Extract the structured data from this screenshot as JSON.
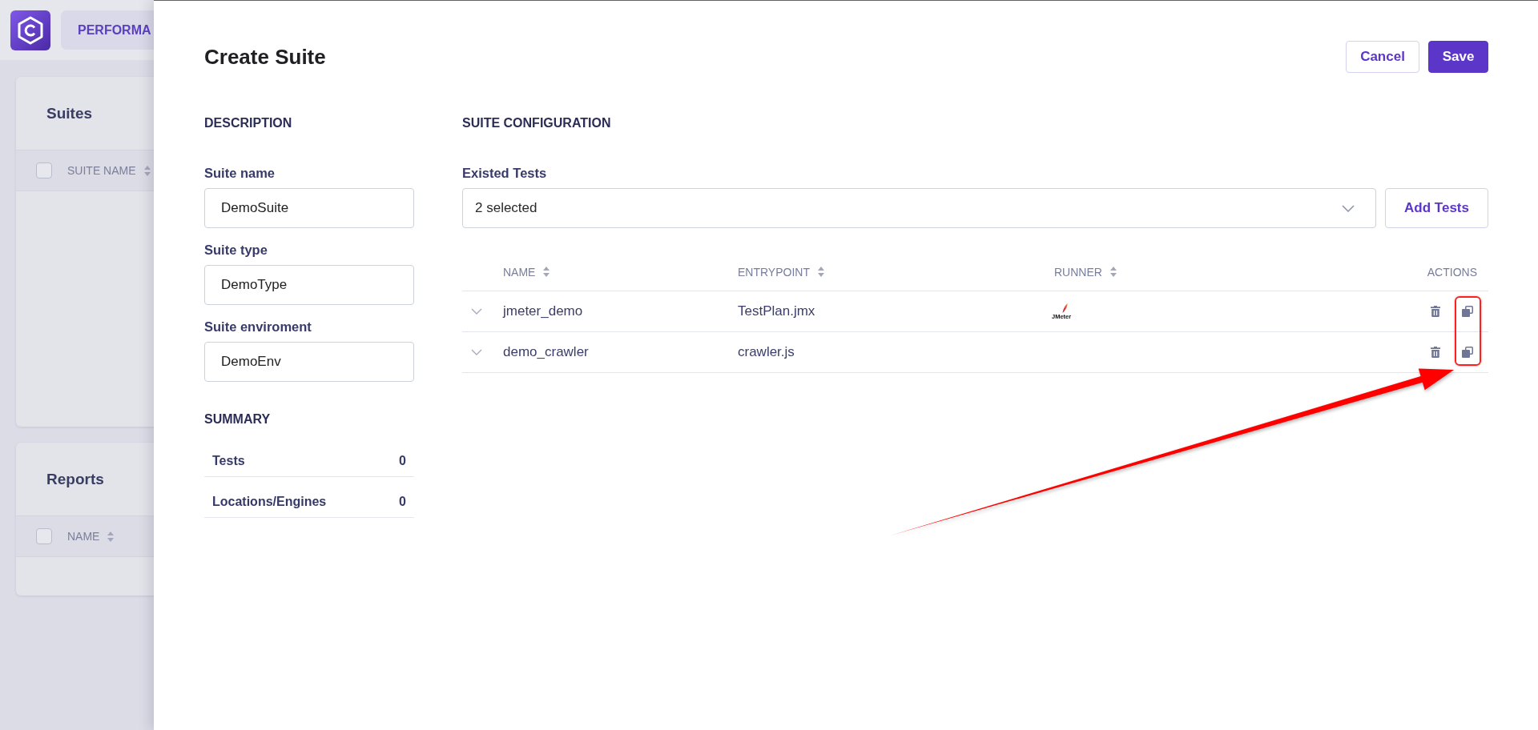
{
  "background": {
    "nav_tab": "PERFORMA",
    "cards": [
      {
        "title": "Suites",
        "select_all_checked": false,
        "columns": [
          {
            "label": "SUITE NAME",
            "sortable": true
          }
        ]
      },
      {
        "title": "Reports",
        "select_all_checked": false,
        "columns": [
          {
            "label": "NAME",
            "sortable": true
          }
        ]
      }
    ]
  },
  "drawer": {
    "title": "Create Suite",
    "buttons": [
      {
        "label": "Cancel",
        "kind": "secondary"
      },
      {
        "label": "Save",
        "kind": "primary"
      }
    ]
  },
  "description": {
    "heading": "DESCRIPTION",
    "fields": [
      {
        "label": "Suite name",
        "value": "DemoSuite"
      },
      {
        "label": "Suite type",
        "value": "DemoType"
      },
      {
        "label": "Suite enviroment",
        "value": "DemoEnv"
      }
    ]
  },
  "summary": {
    "heading": "SUMMARY",
    "rows": [
      {
        "label": "Tests",
        "value": "0"
      },
      {
        "label": "Locations/Engines",
        "value": "0"
      }
    ]
  },
  "suite_configuration": {
    "heading": "SUITE CONFIGURATION",
    "existed_tests": {
      "label": "Existed Tests",
      "value": "2 selected"
    },
    "add_button": "Add Tests",
    "table": {
      "columns": [
        {
          "label": "NAME",
          "sortable": true
        },
        {
          "label": "ENTRYPOINT",
          "sortable": true
        },
        {
          "label": "RUNNER",
          "sortable": true
        },
        {
          "label": "ACTIONS",
          "sortable": false
        }
      ],
      "rows": [
        {
          "name": "jmeter_demo",
          "entrypoint": "TestPlan.jmx",
          "runner": "JMeter"
        },
        {
          "name": "demo_crawler",
          "entrypoint": "crawler.js"
        }
      ]
    }
  }
}
